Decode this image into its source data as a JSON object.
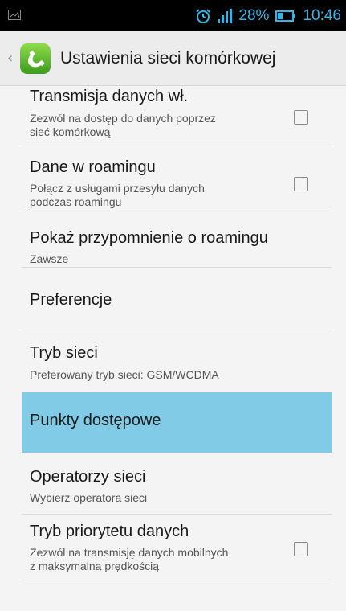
{
  "status_bar": {
    "battery_percent": "28%",
    "time": "10:46",
    "icons": [
      "image-icon",
      "alarm-clock-icon",
      "signal-icon",
      "battery-icon"
    ]
  },
  "action_bar": {
    "title": "Ustawienia sieci komórkowej",
    "icon": "phone-app-icon"
  },
  "settings": [
    {
      "title": "Transmisja danych wł.",
      "summary": [
        "Zezwól na dostęp do danych poprzez",
        "sieć komórkową"
      ],
      "checkbox": true,
      "checked": false
    },
    {
      "title": "Dane w roamingu",
      "summary": [
        "Połącz z usługami przesyłu danych",
        "podczas roamingu"
      ],
      "checkbox": true,
      "checked": false
    },
    {
      "title": "Pokaż przypomnienie o roamingu",
      "summary": [
        "Zawsze"
      ],
      "checkbox": false
    },
    {
      "title": "Preferencje",
      "summary": [],
      "checkbox": false
    },
    {
      "title": "Tryb sieci",
      "summary": [
        "Preferowany tryb sieci: GSM/WCDMA"
      ],
      "checkbox": false
    },
    {
      "title": "Punkty dostępowe",
      "summary": [],
      "checkbox": false,
      "highlighted": true
    },
    {
      "title": "Operatorzy sieci",
      "summary": [
        "Wybierz operatora sieci"
      ],
      "checkbox": false
    },
    {
      "title": "Tryb priorytetu danych",
      "summary": [
        "Zezwól na transmisję danych mobilnych",
        "z maksymalną prędkością"
      ],
      "checkbox": true,
      "checked": false
    }
  ],
  "colors": {
    "accent": "#33b5e5",
    "highlight": "#81cbe6",
    "background": "#f4f4f4"
  }
}
